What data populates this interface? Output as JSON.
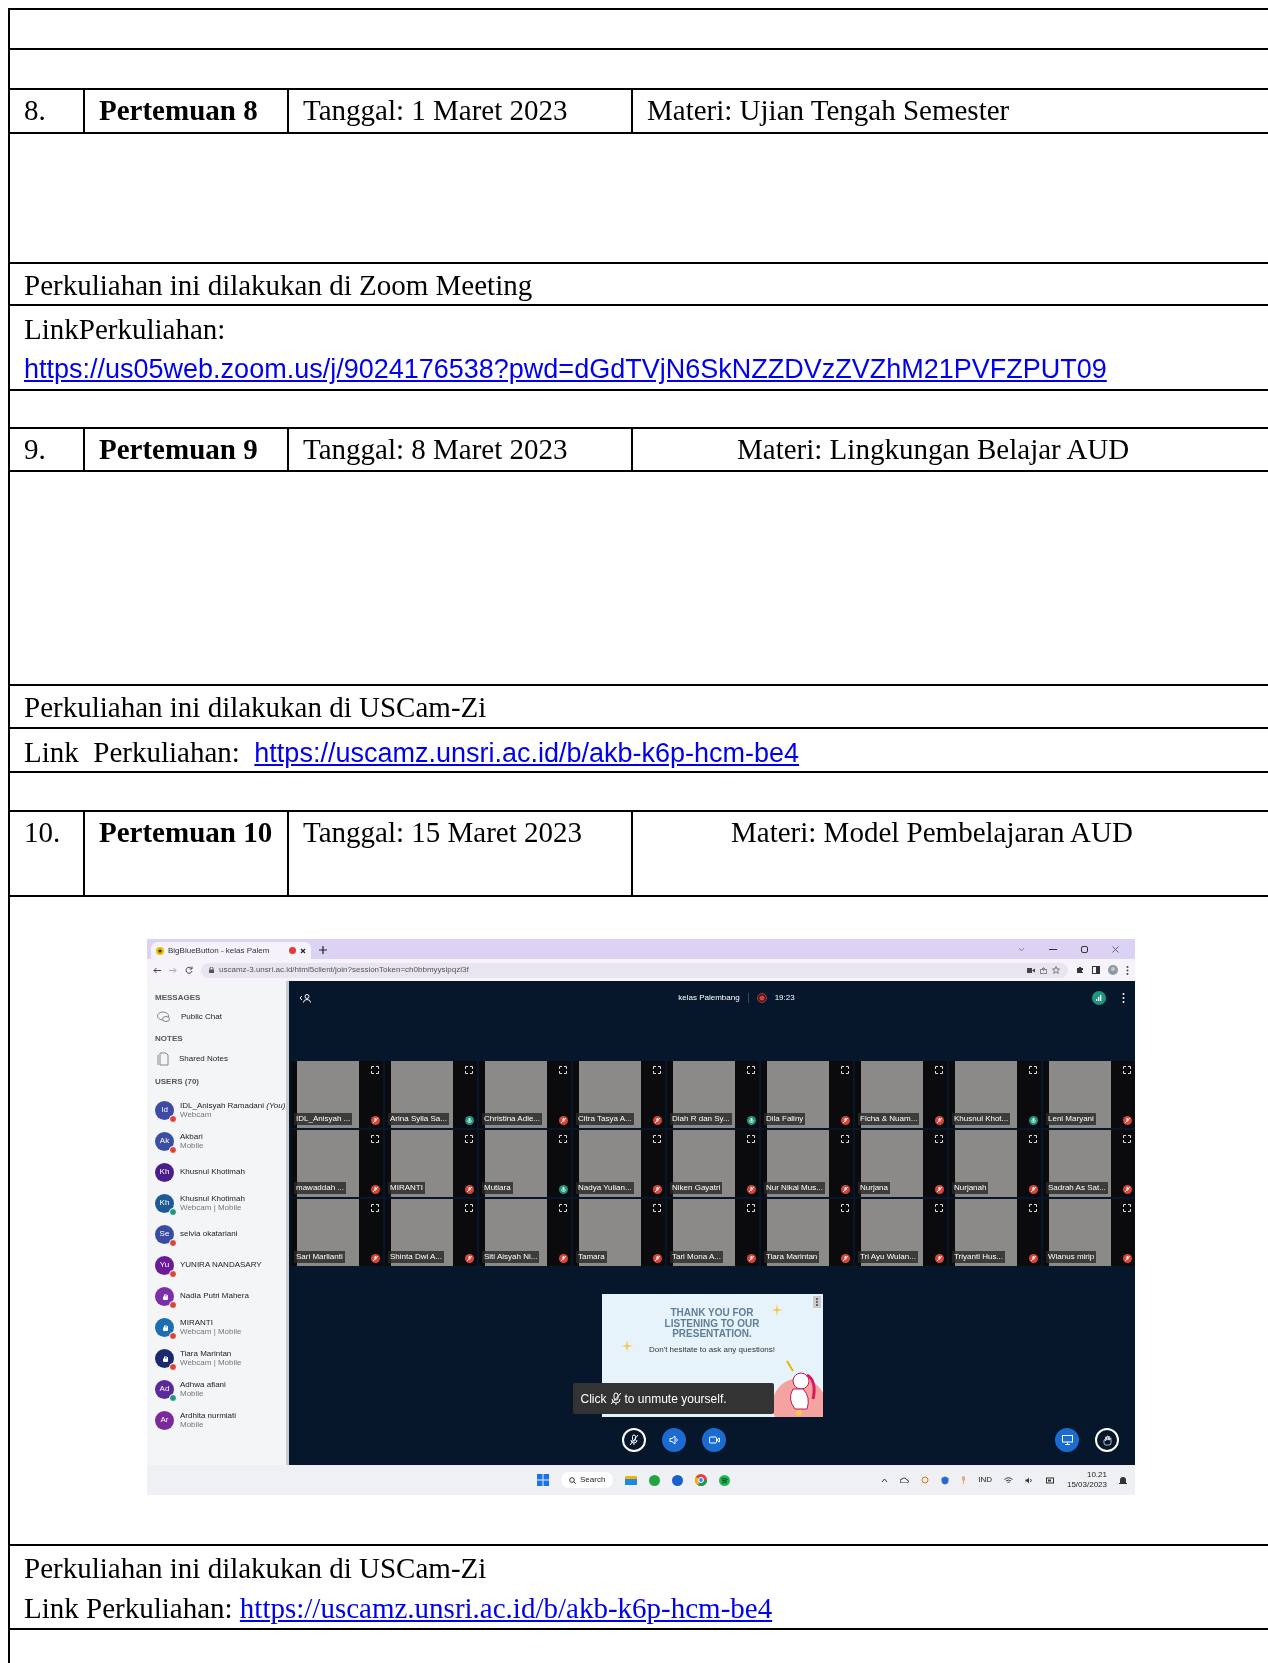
{
  "document": {
    "meetings": [
      {
        "number": "8.",
        "title": "Pertemuan 8",
        "date": "Tanggal: 1 Maret 2023",
        "topic": "Materi: Ujian Tengah Semester",
        "note": "Perkuliahan ini dilakukan di Zoom Meeting",
        "link_label": "LinkPerkuliahan:",
        "link": "https://us05web.zoom.us/j/9024176538?pwd=dGdTVjN6SkNZZDVzZVZhM21PVFZPUT09"
      },
      {
        "number": "9.",
        "title": "Pertemuan 9",
        "date": "Tanggal: 8 Maret 2023",
        "topic": "Materi: Lingkungan Belajar AUD",
        "note": "Perkuliahan ini dilakukan di USCam-Zi",
        "link_label": "Link  Perkuliahan:",
        "link": "https://uscamz.unsri.ac.id/b/akb-k6p-hcm-be4"
      },
      {
        "number": "10.",
        "title": "Pertemuan 10",
        "date": "Tanggal: 15 Maret 2023",
        "topic": "Materi: Model Pembelajaran AUD",
        "note": "Perkuliahan ini dilakukan di USCam-Zi",
        "link_label": "Link Perkuliahan:",
        "link": "https://uscamz.unsri.ac.id/b/akb-k6p-hcm-be4",
        "screenshot": {
          "browser": {
            "tab_title": "BigBlueButton - kelas Palem",
            "url": "uscamz-3.unsri.ac.id/html5client/join?sessionToken=ch0bbmyysipqzl3f"
          },
          "sidebar": {
            "messages_heading": "MESSAGES",
            "public_chat": "Public Chat",
            "notes_heading": "NOTES",
            "shared_notes": "Shared Notes",
            "users_heading": "USERS (70)",
            "users": [
              {
                "initials": "Id",
                "name": "IDL_Anisyah Ramadani *(You)*",
                "device": "Webcam",
                "color": "#3d4aa6",
                "muted": true,
                "listening": false
              },
              {
                "initials": "Ak",
                "name": "Akbari",
                "device": "Mobile",
                "color": "#3b4ea6",
                "muted": true,
                "listening": false
              },
              {
                "initials": "Kh",
                "name": "Khusnul Khotimah",
                "color": "#4b1d8c",
                "muted": false,
                "listening": false
              },
              {
                "initials": "Kh",
                "name": "Khusnul Khotimah",
                "device": "Webcam | Mobile",
                "color": "#1f5a98",
                "muted": false,
                "listening": true
              },
              {
                "initials": "Se",
                "name": "selvia okatariani",
                "color": "#3a4ba3",
                "muted": true,
                "listening": false
              },
              {
                "initials": "Yu",
                "name": "YUNIRA NANDASARY",
                "color": "#6a1b9a",
                "muted": true,
                "listening": false
              },
              {
                "name": "Nadia Putri Mahera",
                "color": "#7b2fa8",
                "muted": true,
                "listening": false
              },
              {
                "name": "MIRANTI",
                "device": "Webcam | Mobile",
                "color": "#1b6fb0",
                "muted": true,
                "listening": false
              },
              {
                "name": "Tiara Marintan",
                "device": "Webcam | Mobile",
                "color": "#1a2a6c",
                "muted": true,
                "listening": false
              },
              {
                "initials": "Ad",
                "name": "Adhwa afiani",
                "device": "Mobile",
                "color": "#5a2a9a",
                "muted": false,
                "listening": true
              },
              {
                "initials": "Ar",
                "name": "Ardhita nurmiati",
                "device": "Mobile",
                "color": "#7a2a9a",
                "muted": false,
                "listening": false
              }
            ]
          },
          "meeting_bar": {
            "title": "kelas Palembang",
            "recording_time": "19:23"
          },
          "video_tiles": [
            {
              "name": "IDL_Anisyah ...",
              "muted": true
            },
            {
              "name": "Arina Sylla Sa...",
              "muted": false
            },
            {
              "name": "Christina Adie...",
              "muted": true
            },
            {
              "name": "Citra Tasya A...",
              "muted": true
            },
            {
              "name": "Diah R dan Sy...",
              "muted": false
            },
            {
              "name": "Dila Faliny",
              "muted": true
            },
            {
              "name": "Ficha & Nuam...",
              "muted": true
            },
            {
              "name": "Khusnul Khot...",
              "muted": false
            },
            {
              "name": "Leni Maryani",
              "muted": true
            },
            {
              "name": "mawaddah ...",
              "muted": true
            },
            {
              "name": "MIRANTI",
              "muted": true
            },
            {
              "name": "Mutiara",
              "muted": false
            },
            {
              "name": "Nadya Yulian...",
              "muted": true
            },
            {
              "name": "Niken Gayatri",
              "muted": true
            },
            {
              "name": "Nur Nikal Mus...",
              "muted": true
            },
            {
              "name": "Nurjana",
              "muted": true
            },
            {
              "name": "Nurjanah",
              "muted": true
            },
            {
              "name": "Sadrah As Sat...",
              "muted": true
            },
            {
              "name": "Sari Marlianti",
              "muted": true
            },
            {
              "name": "Shinta Dwi A...",
              "muted": true
            },
            {
              "name": "Siti Aisyah Ni...",
              "muted": true
            },
            {
              "name": "Tamara",
              "muted": true
            },
            {
              "name": "Tari Mona A...",
              "muted": true
            },
            {
              "name": "Tiara Marintan",
              "muted": true
            },
            {
              "name": "Tri Ayu Wulan...",
              "muted": true
            },
            {
              "name": "Triyanti Hus...",
              "muted": true
            },
            {
              "name": "Wianus mirip",
              "muted": true
            }
          ],
          "slide": {
            "heading": "THANK YOU FOR LISTENING TO OUR PRESENTATION.",
            "subtext": "Don't hesitate to ask any questions!"
          },
          "tooltip": {
            "before": "Click",
            "after": "to unmute yourself."
          },
          "taskbar": {
            "search": "Search",
            "language": "IND",
            "time": "10.21",
            "date": "15/03/2023"
          }
        }
      }
    ]
  }
}
